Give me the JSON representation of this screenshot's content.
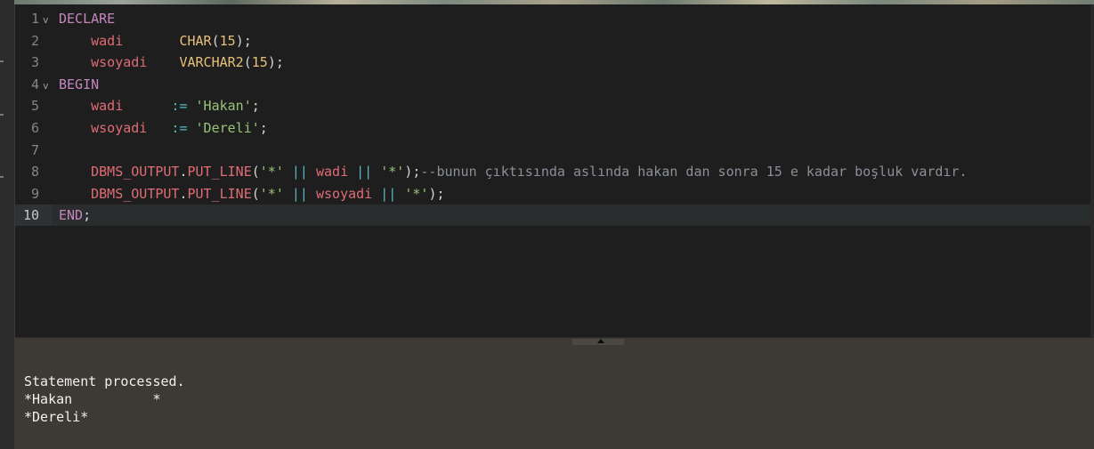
{
  "editor": {
    "lines": [
      {
        "num": "1",
        "fold": "v",
        "active": false,
        "tokens": [
          {
            "t": "DECLARE",
            "c": "kw"
          }
        ]
      },
      {
        "num": "2",
        "active": false,
        "tokens": [
          {
            "t": "    ",
            "c": "punc"
          },
          {
            "t": "wadi",
            "c": "var"
          },
          {
            "t": "       ",
            "c": "punc"
          },
          {
            "t": "CHAR",
            "c": "type"
          },
          {
            "t": "(",
            "c": "punc"
          },
          {
            "t": "15",
            "c": "num-lit"
          },
          {
            "t": ");",
            "c": "punc"
          }
        ]
      },
      {
        "num": "3",
        "active": false,
        "tokens": [
          {
            "t": "    ",
            "c": "punc"
          },
          {
            "t": "wsoyadi",
            "c": "var"
          },
          {
            "t": "    ",
            "c": "punc"
          },
          {
            "t": "VARCHAR2",
            "c": "type"
          },
          {
            "t": "(",
            "c": "punc"
          },
          {
            "t": "15",
            "c": "num-lit"
          },
          {
            "t": ");",
            "c": "punc"
          }
        ]
      },
      {
        "num": "4",
        "fold": "v",
        "active": false,
        "tokens": [
          {
            "t": "BEGIN",
            "c": "kw"
          }
        ]
      },
      {
        "num": "5",
        "active": false,
        "tokens": [
          {
            "t": "    ",
            "c": "punc"
          },
          {
            "t": "wadi",
            "c": "var"
          },
          {
            "t": "      ",
            "c": "punc"
          },
          {
            "t": ":=",
            "c": "op"
          },
          {
            "t": " ",
            "c": "punc"
          },
          {
            "t": "'Hakan'",
            "c": "str"
          },
          {
            "t": ";",
            "c": "punc"
          }
        ]
      },
      {
        "num": "6",
        "active": false,
        "tokens": [
          {
            "t": "    ",
            "c": "punc"
          },
          {
            "t": "wsoyadi",
            "c": "var"
          },
          {
            "t": "   ",
            "c": "punc"
          },
          {
            "t": ":=",
            "c": "op"
          },
          {
            "t": " ",
            "c": "punc"
          },
          {
            "t": "'Dereli'",
            "c": "str"
          },
          {
            "t": ";",
            "c": "punc"
          }
        ]
      },
      {
        "num": "7",
        "active": false,
        "tokens": []
      },
      {
        "num": "8",
        "active": false,
        "tokens": [
          {
            "t": "    ",
            "c": "punc"
          },
          {
            "t": "DBMS_OUTPUT",
            "c": "var"
          },
          {
            "t": ".",
            "c": "punc"
          },
          {
            "t": "PUT_LINE",
            "c": "var"
          },
          {
            "t": "(",
            "c": "punc"
          },
          {
            "t": "'*'",
            "c": "str"
          },
          {
            "t": " ",
            "c": "punc"
          },
          {
            "t": "||",
            "c": "op"
          },
          {
            "t": " ",
            "c": "punc"
          },
          {
            "t": "wadi",
            "c": "var"
          },
          {
            "t": " ",
            "c": "punc"
          },
          {
            "t": "||",
            "c": "op"
          },
          {
            "t": " ",
            "c": "punc"
          },
          {
            "t": "'*'",
            "c": "str"
          },
          {
            "t": ");",
            "c": "punc"
          },
          {
            "t": "--bunun çıktısında aslında hakan dan sonra 15 e kadar boşluk vardır.",
            "c": "cmt"
          }
        ]
      },
      {
        "num": "9",
        "active": false,
        "tokens": [
          {
            "t": "    ",
            "c": "punc"
          },
          {
            "t": "DBMS_OUTPUT",
            "c": "var"
          },
          {
            "t": ".",
            "c": "punc"
          },
          {
            "t": "PUT_LINE",
            "c": "var"
          },
          {
            "t": "(",
            "c": "punc"
          },
          {
            "t": "'*'",
            "c": "str"
          },
          {
            "t": " ",
            "c": "punc"
          },
          {
            "t": "||",
            "c": "op"
          },
          {
            "t": " ",
            "c": "punc"
          },
          {
            "t": "wsoyadi",
            "c": "var"
          },
          {
            "t": " ",
            "c": "punc"
          },
          {
            "t": "||",
            "c": "op"
          },
          {
            "t": " ",
            "c": "punc"
          },
          {
            "t": "'*'",
            "c": "str"
          },
          {
            "t": ");",
            "c": "punc"
          }
        ]
      },
      {
        "num": "10",
        "active": true,
        "tokens": [
          {
            "t": "END",
            "c": "kw"
          },
          {
            "t": ";",
            "c": "punc"
          }
        ]
      }
    ]
  },
  "output": {
    "lines": [
      "Statement processed.",
      "*Hakan          *",
      "*Dereli*"
    ]
  }
}
